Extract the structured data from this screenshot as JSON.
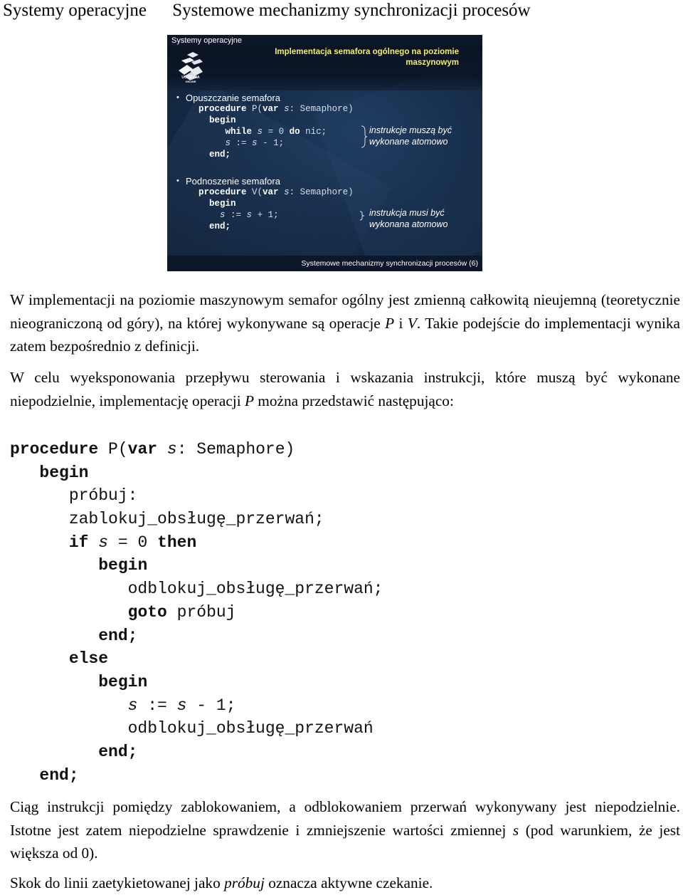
{
  "header": {
    "course": "Systemy operacyjne",
    "topic": "Systemowe mechanizmy synchronizacji procesów"
  },
  "slide": {
    "course_label": "Systemy operacyjne",
    "title_line1": "Implementacja semafora ogólnego na poziomie",
    "title_line2": "maszynowym",
    "logo_text_line1": "UCZELNIA",
    "logo_text_line2": "ONLINE",
    "title_color": "#f2ee6a",
    "background_color": "#152c49",
    "section_p": {
      "bullet": "Opuszczanie semafora",
      "code": [
        [
          {
            "t": "procedure",
            "s": "kw"
          },
          {
            "t": " P(",
            "s": "n"
          },
          {
            "t": "var",
            "s": "kw"
          },
          {
            "t": " ",
            "s": "n"
          },
          {
            "t": "s",
            "s": "it"
          },
          {
            "t": ": Semaphore)",
            "s": "n"
          }
        ],
        [
          {
            "t": "  ",
            "s": "n"
          },
          {
            "t": "begin",
            "s": "kw"
          }
        ],
        [
          {
            "t": "     ",
            "s": "n"
          },
          {
            "t": "while",
            "s": "kw"
          },
          {
            "t": " ",
            "s": "n"
          },
          {
            "t": "s",
            "s": "it"
          },
          {
            "t": " = 0 ",
            "s": "n"
          },
          {
            "t": "do",
            "s": "kw"
          },
          {
            "t": " nic;",
            "s": "n"
          }
        ],
        [
          {
            "t": "     ",
            "s": "n"
          },
          {
            "t": "s",
            "s": "it"
          },
          {
            "t": " := ",
            "s": "n"
          },
          {
            "t": "s",
            "s": "it"
          },
          {
            "t": " - 1;",
            "s": "n"
          }
        ],
        [
          {
            "t": "  ",
            "s": "n"
          },
          {
            "t": "end;",
            "s": "kw"
          }
        ]
      ],
      "note_line1": "instrukcje muszą być",
      "note_line2": "wykonane atomowo"
    },
    "section_v": {
      "bullet": "Podnoszenie semafora",
      "code": [
        [
          {
            "t": "procedure",
            "s": "kw"
          },
          {
            "t": " V(",
            "s": "n"
          },
          {
            "t": "var",
            "s": "kw"
          },
          {
            "t": " ",
            "s": "n"
          },
          {
            "t": "s",
            "s": "it"
          },
          {
            "t": ": Semaphore)",
            "s": "n"
          }
        ],
        [
          {
            "t": "  ",
            "s": "n"
          },
          {
            "t": "begin",
            "s": "kw"
          }
        ],
        [
          {
            "t": "    ",
            "s": "n"
          },
          {
            "t": "s",
            "s": "it"
          },
          {
            "t": " := ",
            "s": "n"
          },
          {
            "t": "s",
            "s": "it"
          },
          {
            "t": " + 1;",
            "s": "n"
          }
        ],
        [
          {
            "t": "  ",
            "s": "n"
          },
          {
            "t": "end;",
            "s": "kw"
          }
        ]
      ],
      "note_line1": "instrukcja musi być",
      "note_line2": "wykonana atomowo"
    },
    "footer": "Systemowe mechanizmy synchronizacji procesów (6)"
  },
  "paragraphs": {
    "p1": [
      {
        "t": "W implementacji na poziomie maszynowym semafor ogólny jest zmienną całkowitą nieujemną (teoretycznie nieograniczoną od góry), na której wykonywane są operacje ",
        "s": "n"
      },
      {
        "t": "P",
        "s": "it"
      },
      {
        "t": " i ",
        "s": "n"
      },
      {
        "t": "V",
        "s": "it"
      },
      {
        "t": ". Takie podejście do implementacji wynika zatem bezpośrednio z definicji.",
        "s": "n"
      }
    ],
    "p2": [
      {
        "t": "W celu wyeksponowania przepływu sterowania i wskazania instrukcji, które muszą być wykonane niepodzielnie, implementację operacji ",
        "s": "n"
      },
      {
        "t": "P",
        "s": "it"
      },
      {
        "t": " można przedstawić następująco:",
        "s": "n"
      }
    ],
    "p3": [
      {
        "t": "Ciąg instrukcji pomiędzy zablokowaniem, a odblokowaniem przerwań wykonywany jest niepodzielnie. Istotne jest zatem niepodzielne sprawdzenie i zmniejszenie wartości zmiennej ",
        "s": "n"
      },
      {
        "t": "s",
        "s": "it"
      },
      {
        "t": " (pod warunkiem, że jest większa od 0).",
        "s": "n"
      }
    ],
    "p4": [
      {
        "t": "Skok do linii zaetykietowanej jako ",
        "s": "n"
      },
      {
        "t": "próbuj",
        "s": "it"
      },
      {
        "t": " oznacza aktywne czekanie.",
        "s": "n"
      }
    ]
  },
  "code_listing": [
    [
      {
        "t": "procedure",
        "s": "kw"
      },
      {
        "t": " P(",
        "s": "n"
      },
      {
        "t": "var",
        "s": "kw"
      },
      {
        "t": " ",
        "s": "n"
      },
      {
        "t": "s",
        "s": "it"
      },
      {
        "t": ": Semaphore)",
        "s": "n"
      }
    ],
    [
      {
        "t": "   ",
        "s": "n"
      },
      {
        "t": "begin",
        "s": "kw"
      }
    ],
    [
      {
        "t": "      próbuj:",
        "s": "n"
      }
    ],
    [
      {
        "t": "      zablokuj_obsługę_przerwań;",
        "s": "n"
      }
    ],
    [
      {
        "t": "      ",
        "s": "n"
      },
      {
        "t": "if",
        "s": "kw"
      },
      {
        "t": " ",
        "s": "n"
      },
      {
        "t": "s",
        "s": "it"
      },
      {
        "t": " = 0 ",
        "s": "n"
      },
      {
        "t": "then",
        "s": "kw"
      }
    ],
    [
      {
        "t": "         ",
        "s": "n"
      },
      {
        "t": "begin",
        "s": "kw"
      }
    ],
    [
      {
        "t": "            odblokuj_obsługę_przerwań;",
        "s": "n"
      }
    ],
    [
      {
        "t": "            ",
        "s": "n"
      },
      {
        "t": "goto",
        "s": "kw"
      },
      {
        "t": " próbuj",
        "s": "n"
      }
    ],
    [
      {
        "t": "         ",
        "s": "n"
      },
      {
        "t": "end;",
        "s": "kw"
      }
    ],
    [
      {
        "t": "      ",
        "s": "n"
      },
      {
        "t": "else",
        "s": "kw"
      }
    ],
    [
      {
        "t": "         ",
        "s": "n"
      },
      {
        "t": "begin",
        "s": "kw"
      }
    ],
    [
      {
        "t": "            ",
        "s": "n"
      },
      {
        "t": "s",
        "s": "it"
      },
      {
        "t": " := ",
        "s": "n"
      },
      {
        "t": "s",
        "s": "it"
      },
      {
        "t": " - 1;",
        "s": "n"
      }
    ],
    [
      {
        "t": "            odblokuj_obsługę_przerwań",
        "s": "n"
      }
    ],
    [
      {
        "t": "         ",
        "s": "n"
      },
      {
        "t": "end;",
        "s": "kw"
      }
    ],
    [
      {
        "t": "   ",
        "s": "n"
      },
      {
        "t": "end;",
        "s": "kw"
      }
    ]
  ]
}
